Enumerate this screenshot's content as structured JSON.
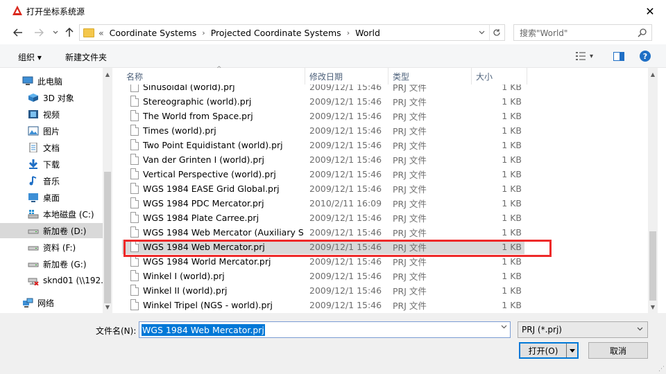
{
  "window": {
    "title": "打开坐标系统源",
    "close_glyph": "✕"
  },
  "address": {
    "prefix": "«",
    "crumbs": [
      "Coordinate Systems",
      "Projected Coordinate Systems",
      "World"
    ],
    "search_placeholder": "搜索\"World\""
  },
  "toolbar": {
    "organize": "组织 ▾",
    "new_folder": "新建文件夹",
    "view_caret": "▾"
  },
  "nav": {
    "items": [
      {
        "label": "此电脑",
        "icon": "computer-icon"
      },
      {
        "label": "3D 对象",
        "icon": "cube-icon"
      },
      {
        "label": "视频",
        "icon": "video-icon"
      },
      {
        "label": "图片",
        "icon": "picture-icon"
      },
      {
        "label": "文档",
        "icon": "document-icon"
      },
      {
        "label": "下载",
        "icon": "download-icon"
      },
      {
        "label": "音乐",
        "icon": "music-icon"
      },
      {
        "label": "桌面",
        "icon": "desktop-icon"
      },
      {
        "label": "本地磁盘 (C:)",
        "icon": "windows-drive-icon"
      },
      {
        "label": "新加卷 (D:)",
        "icon": "drive-icon"
      },
      {
        "label": "资料 (F:)",
        "icon": "drive-icon"
      },
      {
        "label": "新加卷 (G:)",
        "icon": "drive-icon"
      },
      {
        "label": "sknd01 (\\\\192.1",
        "icon": "network-drive-disconnected-icon"
      },
      {
        "label": "网络",
        "icon": "network-icon"
      }
    ]
  },
  "columns": {
    "name": "名称",
    "date": "修改日期",
    "type": "类型",
    "size": "大小"
  },
  "files": [
    {
      "name": "Sinusoidal (world).prj",
      "date": "2009/12/1 15:46",
      "type": "PRJ 文件",
      "size": "1 KB"
    },
    {
      "name": "Stereographic (world).prj",
      "date": "2009/12/1 15:46",
      "type": "PRJ 文件",
      "size": "1 KB"
    },
    {
      "name": "The World from Space.prj",
      "date": "2009/12/1 15:46",
      "type": "PRJ 文件",
      "size": "1 KB"
    },
    {
      "name": "Times (world).prj",
      "date": "2009/12/1 15:46",
      "type": "PRJ 文件",
      "size": "1 KB"
    },
    {
      "name": "Two Point Equidistant (world).prj",
      "date": "2009/12/1 15:46",
      "type": "PRJ 文件",
      "size": "1 KB"
    },
    {
      "name": "Van der Grinten I (world).prj",
      "date": "2009/12/1 15:46",
      "type": "PRJ 文件",
      "size": "1 KB"
    },
    {
      "name": "Vertical Perspective (world).prj",
      "date": "2009/12/1 15:46",
      "type": "PRJ 文件",
      "size": "1 KB"
    },
    {
      "name": "WGS 1984 EASE Grid Global.prj",
      "date": "2009/12/1 15:46",
      "type": "PRJ 文件",
      "size": "1 KB"
    },
    {
      "name": "WGS 1984 PDC Mercator.prj",
      "date": "2010/2/11 16:09",
      "type": "PRJ 文件",
      "size": "1 KB"
    },
    {
      "name": "WGS 1984 Plate Carree.prj",
      "date": "2009/12/1 15:46",
      "type": "PRJ 文件",
      "size": "1 KB"
    },
    {
      "name": "WGS 1984 Web Mercator (Auxiliary S...",
      "date": "2009/12/1 15:46",
      "type": "PRJ 文件",
      "size": "1 KB"
    },
    {
      "name": "WGS 1984 Web Mercator.prj",
      "date": "2009/12/1 15:46",
      "type": "PRJ 文件",
      "size": "1 KB"
    },
    {
      "name": "WGS 1984 World Mercator.prj",
      "date": "2009/12/1 15:46",
      "type": "PRJ 文件",
      "size": "1 KB"
    },
    {
      "name": "Winkel I (world).prj",
      "date": "2009/12/1 15:46",
      "type": "PRJ 文件",
      "size": "1 KB"
    },
    {
      "name": "Winkel II (world).prj",
      "date": "2009/12/1 15:46",
      "type": "PRJ 文件",
      "size": "1 KB"
    },
    {
      "name": "Winkel Tripel (NGS - world).prj",
      "date": "2009/12/1 15:46",
      "type": "PRJ 文件",
      "size": "1 KB"
    }
  ],
  "selected_file_index": 11,
  "bottom": {
    "filename_label": "文件名(N):",
    "filename_value": "WGS 1984 Web Mercator.prj",
    "filetype_value": "PRJ (*.prj)",
    "open_label": "打开(O)",
    "cancel_label": "取消"
  },
  "colors": {
    "accent": "#0078d7",
    "highlight_border": "#ee2a2a",
    "selection_bg": "#d9d9d9",
    "app_icon": "#d9281d"
  }
}
